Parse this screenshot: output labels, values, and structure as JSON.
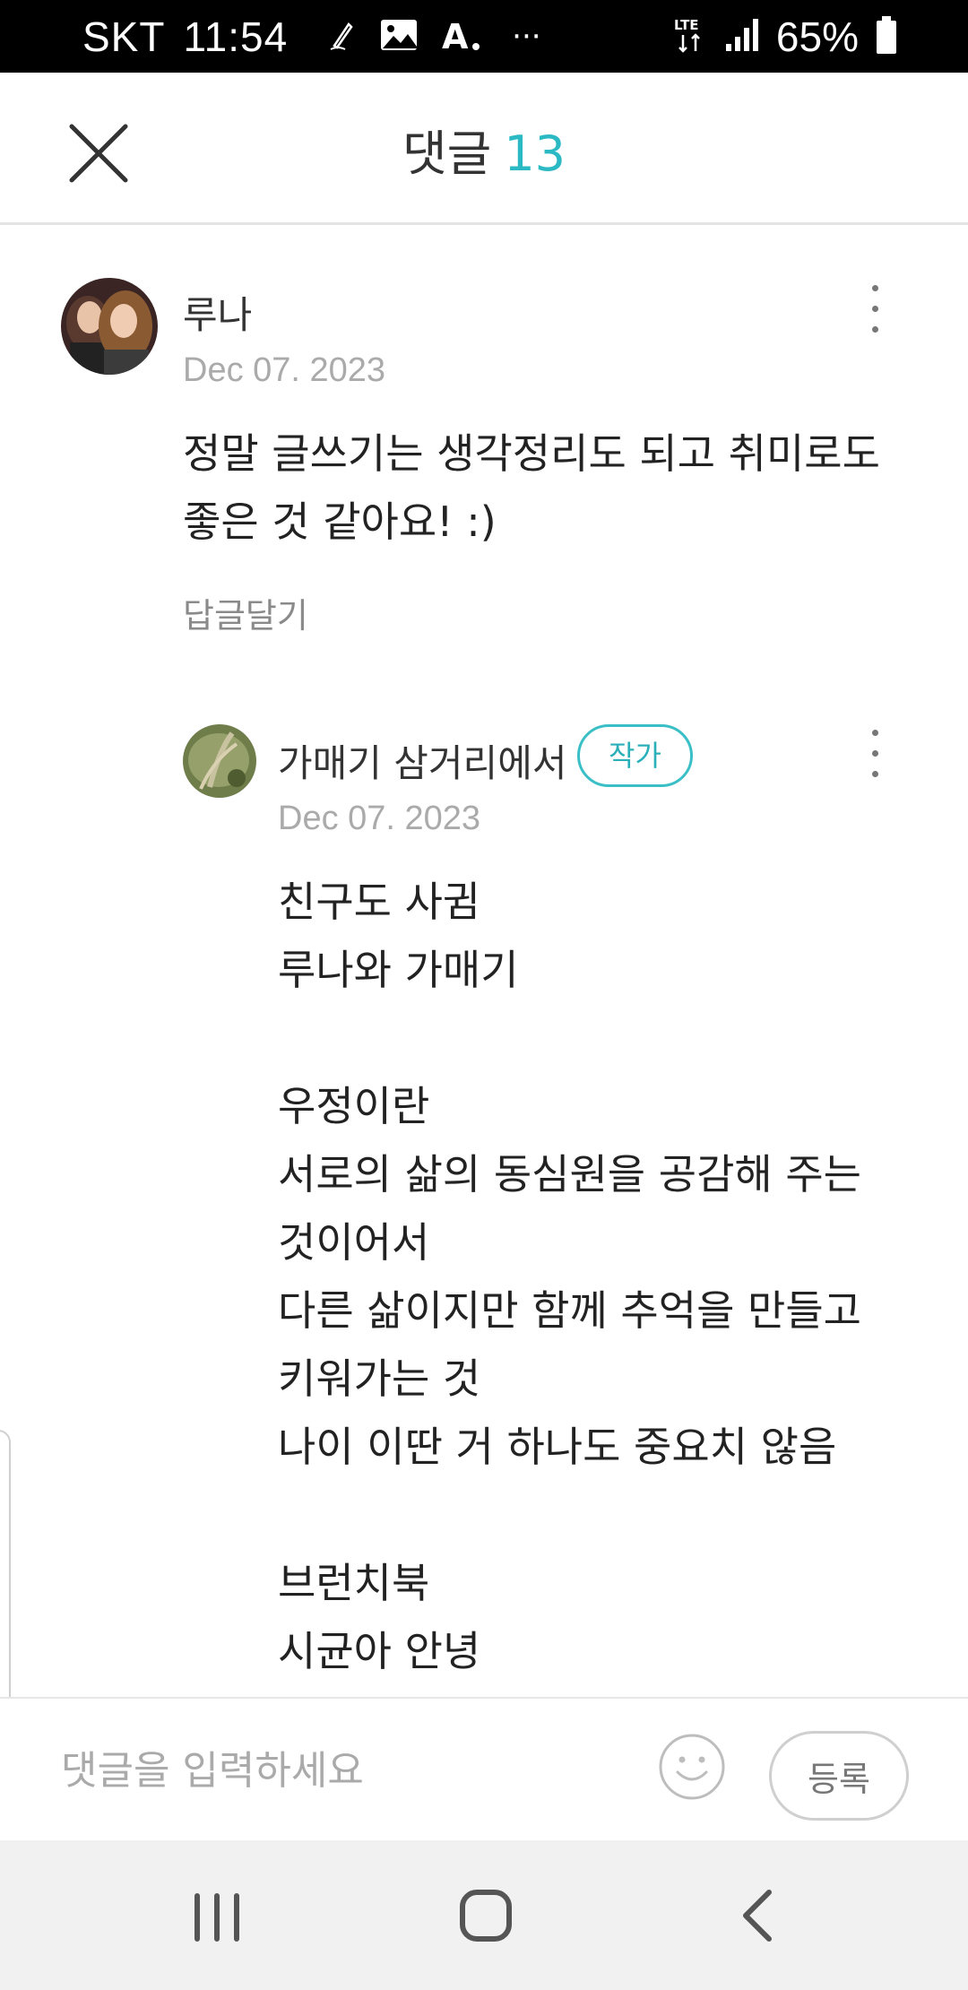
{
  "status_bar": {
    "carrier": "SKT",
    "time": "11:54",
    "network": "LTE",
    "battery": "65%",
    "overflow": "···",
    "icons": [
      "pen-notification-icon",
      "image-notification-icon",
      "font-app-icon",
      "more-notifications-icon",
      "lte-icon",
      "signal-icon",
      "battery-icon"
    ]
  },
  "header": {
    "title": "댓글",
    "count": "13",
    "close_icon": "close-icon"
  },
  "comments": [
    {
      "author": "루나",
      "date": "Dec 07. 2023",
      "text": "정말 글쓰기는 생각정리도 되고 취미로도\n좋은 것 같아요! :)",
      "reply_label": "답글달기"
    }
  ],
  "replies": [
    {
      "author": "가매기 삼거리에서",
      "badge": "작가",
      "date": "Dec 07. 2023",
      "text": "친구도 사귐\n루나와 가매기\n\n우정이란\n서로의 삶의 동심원을 공감해 주는\n것이어서\n다른 삶이지만 함께 추억을 만들고\n키워가는 것\n나이 이딴 거 하나도 중요치 않음\n\n브런치북\n시균아 안녕"
    }
  ],
  "input_bar": {
    "placeholder": "댓글을 입력하세요",
    "submit_label": "등록",
    "emoji_icon": "smiley-icon"
  },
  "nav_bar": {
    "buttons": [
      "recent-apps-icon",
      "home-icon",
      "back-icon"
    ]
  },
  "colors": {
    "accent": "#2bb9c4",
    "status_bar_bg": "#000000",
    "nav_bar_bg": "#f1f1f1"
  }
}
